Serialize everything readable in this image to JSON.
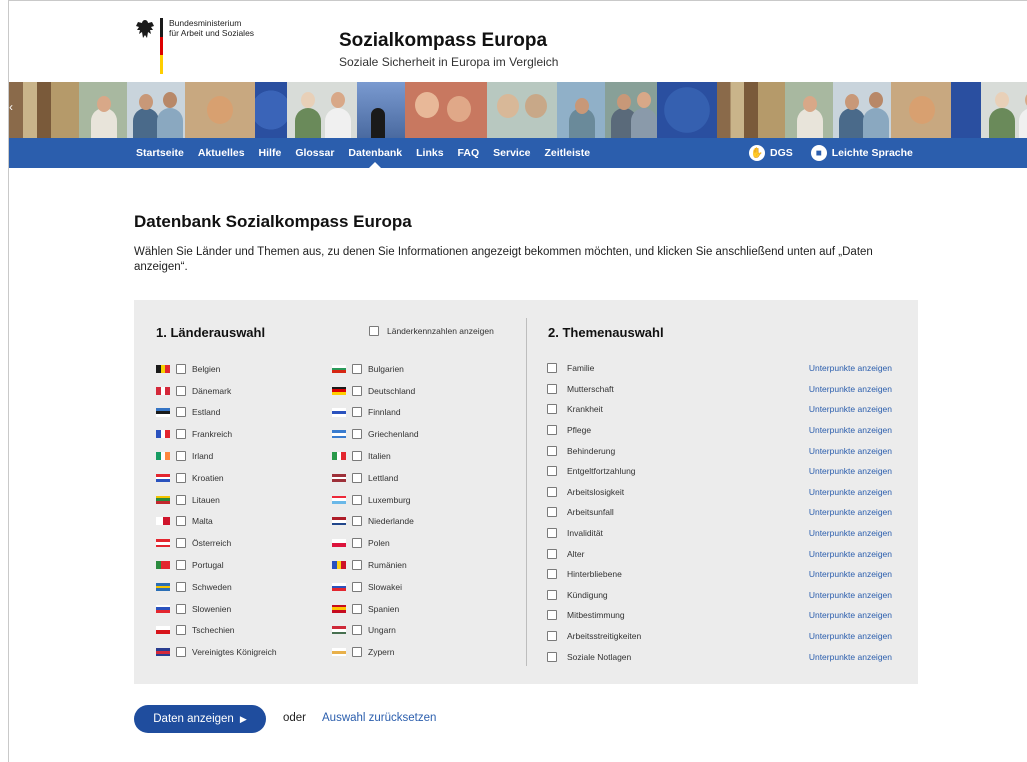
{
  "header": {
    "ministry_line1": "Bundesministerium",
    "ministry_line2": "für Arbeit und Soziales",
    "title": "Sozialkompass Europa",
    "subtitle": "Soziale Sicherheit in Europa im Vergleich"
  },
  "nav": {
    "items": [
      {
        "label": "Startseite"
      },
      {
        "label": "Aktuelles"
      },
      {
        "label": "Hilfe"
      },
      {
        "label": "Glossar"
      },
      {
        "label": "Datenbank",
        "active": true
      },
      {
        "label": "Links"
      },
      {
        "label": "FAQ"
      },
      {
        "label": "Service"
      },
      {
        "label": "Zeitleiste"
      }
    ],
    "dgs_label": "DGS",
    "easy_language_label": "Leichte Sprache"
  },
  "main": {
    "title": "Datenbank Sozialkompass Europa",
    "intro": "Wählen Sie Länder und Themen aus, zu denen Sie Informationen angezeigt bekommen möchten, und klicken Sie anschließend unten auf „Daten anzeigen“."
  },
  "countries": {
    "section_title": "1. Länderauswahl",
    "codes_label": "Länderkennzahlen anzeigen",
    "left": [
      {
        "name": "Belgien",
        "flag": [
          "#1a1a1a",
          "#f5d000",
          "#e3262f"
        ],
        "dir": "v"
      },
      {
        "name": "Dänemark",
        "flag": [
          "#d4283a",
          "#ffffff",
          "#d4283a"
        ],
        "dir": "v"
      },
      {
        "name": "Estland",
        "flag": [
          "#3574c4",
          "#1a1a1a",
          "#ffffff"
        ],
        "dir": "h"
      },
      {
        "name": "Frankreich",
        "flag": [
          "#2a52be",
          "#ffffff",
          "#e3262f"
        ],
        "dir": "v"
      },
      {
        "name": "Irland",
        "flag": [
          "#169b62",
          "#ffffff",
          "#ff883e"
        ],
        "dir": "v"
      },
      {
        "name": "Kroatien",
        "flag": [
          "#e3262f",
          "#ffffff",
          "#2a52be"
        ],
        "dir": "h"
      },
      {
        "name": "Litauen",
        "flag": [
          "#f5c400",
          "#2a8a3e",
          "#c1272d"
        ],
        "dir": "h"
      },
      {
        "name": "Malta",
        "flag": [
          "#ffffff",
          "#cf142b"
        ],
        "dir": "v"
      },
      {
        "name": "Österreich",
        "flag": [
          "#e3262f",
          "#ffffff",
          "#e3262f"
        ],
        "dir": "h"
      },
      {
        "name": "Portugal",
        "flag": [
          "#2a8a3e",
          "#e3262f",
          "#e3262f"
        ],
        "dir": "v"
      },
      {
        "name": "Schweden",
        "flag": [
          "#2a6eb5",
          "#f5c400",
          "#2a6eb5"
        ],
        "dir": "h"
      },
      {
        "name": "Slowenien",
        "flag": [
          "#ffffff",
          "#2a52be",
          "#e3262f"
        ],
        "dir": "h"
      },
      {
        "name": "Tschechien",
        "flag": [
          "#ffffff",
          "#d7141a"
        ],
        "dir": "h"
      },
      {
        "name": "Vereinigtes Königreich",
        "flag": [
          "#2a3d8f",
          "#d4283a",
          "#2a3d8f"
        ],
        "dir": "h"
      }
    ],
    "right": [
      {
        "name": "Bulgarien",
        "flag": [
          "#ffffff",
          "#2a9a5a",
          "#d62612"
        ],
        "dir": "h"
      },
      {
        "name": "Deutschland",
        "flag": [
          "#1a1a1a",
          "#dd0000",
          "#ffce00"
        ],
        "dir": "h"
      },
      {
        "name": "Finnland",
        "flag": [
          "#ffffff",
          "#2a52be",
          "#ffffff"
        ],
        "dir": "h"
      },
      {
        "name": "Griechenland",
        "flag": [
          "#3a7ccf",
          "#ffffff",
          "#3a7ccf"
        ],
        "dir": "h"
      },
      {
        "name": "Italien",
        "flag": [
          "#2a9a4a",
          "#ffffff",
          "#e3262f"
        ],
        "dir": "v"
      },
      {
        "name": "Lettland",
        "flag": [
          "#9e3039",
          "#ffffff",
          "#9e3039"
        ],
        "dir": "h"
      },
      {
        "name": "Luxemburg",
        "flag": [
          "#ed2939",
          "#ffffff",
          "#6ab8e8"
        ],
        "dir": "h"
      },
      {
        "name": "Niederlande",
        "flag": [
          "#ae1c28",
          "#ffffff",
          "#21468b"
        ],
        "dir": "h"
      },
      {
        "name": "Polen",
        "flag": [
          "#ffffff",
          "#dc143c"
        ],
        "dir": "h"
      },
      {
        "name": "Rumänien",
        "flag": [
          "#2a52be",
          "#fcd116",
          "#ce1126"
        ],
        "dir": "v"
      },
      {
        "name": "Slowakei",
        "flag": [
          "#ffffff",
          "#2a52be",
          "#e3262f"
        ],
        "dir": "h"
      },
      {
        "name": "Spanien",
        "flag": [
          "#c60b1e",
          "#ffc400",
          "#c60b1e"
        ],
        "dir": "h"
      },
      {
        "name": "Ungarn",
        "flag": [
          "#ce2939",
          "#ffffff",
          "#477050"
        ],
        "dir": "h"
      },
      {
        "name": "Zypern",
        "flag": [
          "#ffffff",
          "#e8b04a",
          "#ffffff"
        ],
        "dir": "h"
      }
    ]
  },
  "topics": {
    "section_title": "2. Themenauswahl",
    "link_label": "Unterpunkte anzeigen",
    "items": [
      "Familie",
      "Mutterschaft",
      "Krankheit",
      "Pflege",
      "Behinderung",
      "Entgeltfortzahlung",
      "Arbeitslosigkeit",
      "Arbeitsunfall",
      "Invalidität",
      "Alter",
      "Hinterbliebene",
      "Kündigung",
      "Mitbestimmung",
      "Arbeitsstreitigkeiten",
      "Soziale Notlagen"
    ]
  },
  "actions": {
    "show_data_label": "Daten anzeigen",
    "or_label": "oder",
    "reset_label": "Auswahl zurücksetzen"
  }
}
